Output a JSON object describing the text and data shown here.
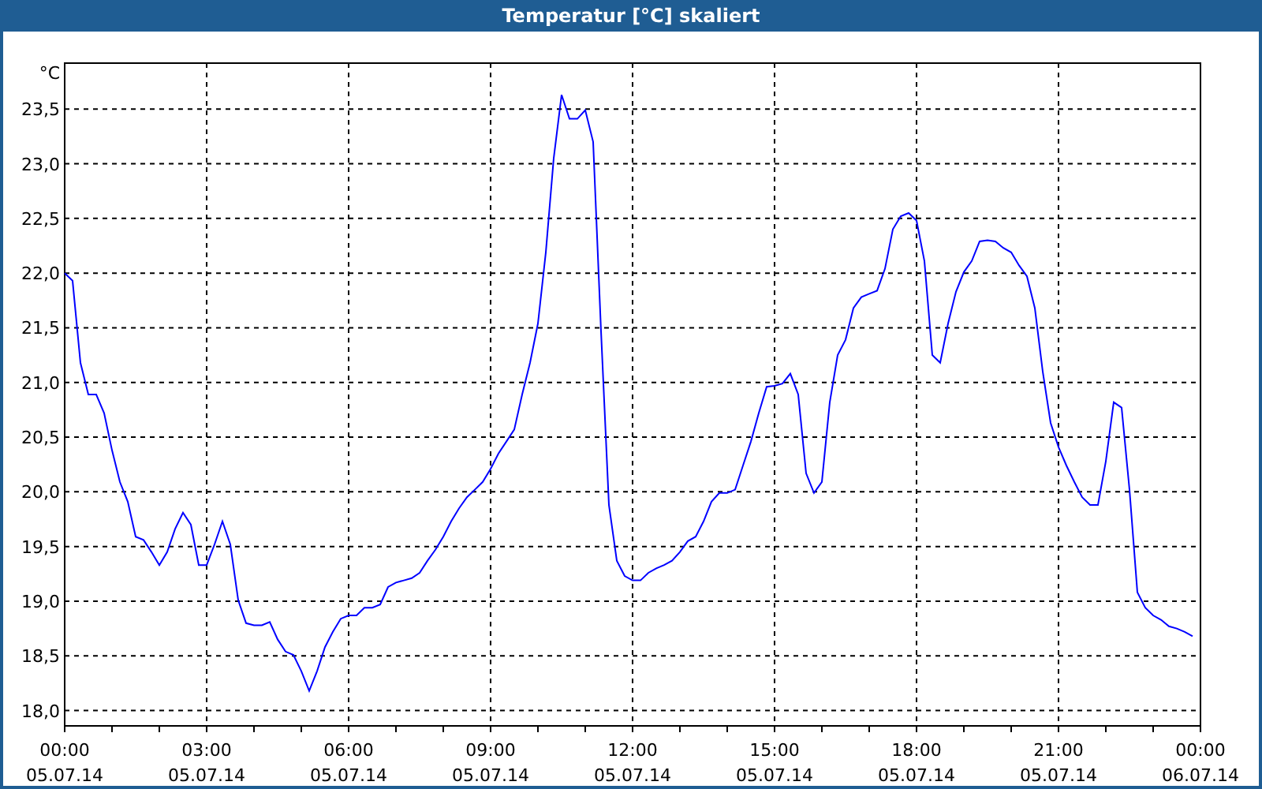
{
  "window": {
    "title": "Temperatur [°C] skaliert"
  },
  "chart": {
    "chart_data": {
      "type": "line",
      "grid": true,
      "ylabel": "°C",
      "categories": [
        "00:00\n05.07.14",
        null,
        null,
        null,
        null,
        null,
        null,
        null,
        null,
        null,
        null,
        null,
        null,
        null,
        null,
        null,
        null,
        null,
        "03:00\n05.07.14",
        null,
        null,
        null,
        null,
        null,
        null,
        null,
        null,
        null,
        null,
        null,
        null,
        null,
        null,
        null,
        null,
        null,
        "06:00\n05.07.14",
        null,
        null,
        null,
        null,
        null,
        null,
        null,
        null,
        null,
        null,
        null,
        null,
        null,
        null,
        null,
        null,
        null,
        "09:00\n05.07.14",
        null,
        null,
        null,
        null,
        null,
        null,
        null,
        null,
        null,
        null,
        null,
        null,
        null,
        null,
        null,
        null,
        null,
        "12:00\n05.07.14",
        null,
        null,
        null,
        null,
        null,
        null,
        null,
        null,
        null,
        null,
        null,
        null,
        null,
        null,
        null,
        null,
        null,
        "15:00\n05.07.14",
        null,
        null,
        null,
        null,
        null,
        null,
        null,
        null,
        null,
        null,
        null,
        null,
        null,
        null,
        null,
        null,
        null,
        "18:00\n05.07.14",
        null,
        null,
        null,
        null,
        null,
        null,
        null,
        null,
        null,
        null,
        null,
        null,
        null,
        null,
        null,
        null,
        null,
        "21:00\n05.07.14",
        null,
        null,
        null,
        null,
        null,
        null,
        null,
        null,
        null,
        null,
        null,
        null,
        null,
        null,
        null,
        null,
        null,
        "00:00\n06.07.14"
      ],
      "series": [
        {
          "color": "#0000ff",
          "values": [
            22.0,
            21.93,
            21.18,
            20.89,
            20.89,
            20.72,
            20.38,
            20.09,
            19.91,
            19.59,
            19.56,
            19.45,
            19.33,
            19.45,
            19.66,
            19.81,
            19.7,
            19.33,
            19.33,
            19.52,
            19.73,
            19.52,
            19.01,
            18.8,
            18.78,
            18.78,
            18.81,
            18.65,
            18.54,
            18.51,
            18.36,
            18.18,
            18.36,
            18.58,
            18.72,
            18.84,
            18.87,
            18.87,
            18.94,
            18.94,
            18.97,
            19.13,
            19.17,
            19.19,
            19.21,
            19.26,
            19.37,
            19.47,
            19.59,
            19.73,
            19.85,
            19.95,
            20.02,
            20.09,
            20.21,
            20.35,
            20.46,
            20.57,
            20.89,
            21.18,
            21.54,
            22.19,
            23.05,
            23.63,
            23.41,
            23.41,
            23.49,
            23.2,
            21.47,
            19.88,
            19.37,
            19.23,
            19.19,
            19.19,
            19.26,
            19.3,
            19.33,
            19.37,
            19.45,
            19.55,
            19.59,
            19.73,
            19.91,
            19.99,
            19.99,
            20.02,
            20.24,
            20.46,
            20.72,
            20.96,
            20.97,
            20.99,
            21.08,
            20.89,
            20.17,
            19.99,
            20.09,
            20.82,
            21.25,
            21.39,
            21.68,
            21.78,
            21.81,
            21.84,
            22.04,
            22.4,
            22.52,
            22.55,
            22.48,
            22.11,
            21.25,
            21.18,
            21.54,
            21.83,
            22.01,
            22.11,
            22.29,
            22.3,
            22.29,
            22.23,
            22.19,
            22.07,
            21.97,
            21.68,
            21.1,
            20.63,
            20.41,
            20.24,
            20.09,
            19.95,
            19.88,
            19.88,
            20.28,
            20.82,
            20.77,
            20.02,
            19.08,
            18.94,
            18.87,
            18.83,
            18.77,
            18.75,
            18.72,
            18.68,
            null
          ]
        }
      ],
      "ylim": [
        17.86,
        23.92
      ],
      "yticks": [
        {
          "value": 18.0,
          "label": "18,0"
        },
        {
          "value": 18.5,
          "label": "18,5"
        },
        {
          "value": 19.0,
          "label": "19,0"
        },
        {
          "value": 19.5,
          "label": "19,5"
        },
        {
          "value": 20.0,
          "label": "20,0"
        },
        {
          "value": 20.5,
          "label": "20,5"
        },
        {
          "value": 21.0,
          "label": "21,0"
        },
        {
          "value": 21.5,
          "label": "21,5"
        },
        {
          "value": 22.0,
          "label": "22,0"
        },
        {
          "value": 22.5,
          "label": "22,5"
        },
        {
          "value": 23.0,
          "label": "23,0"
        },
        {
          "value": 23.5,
          "label": "23,5"
        }
      ]
    }
  }
}
